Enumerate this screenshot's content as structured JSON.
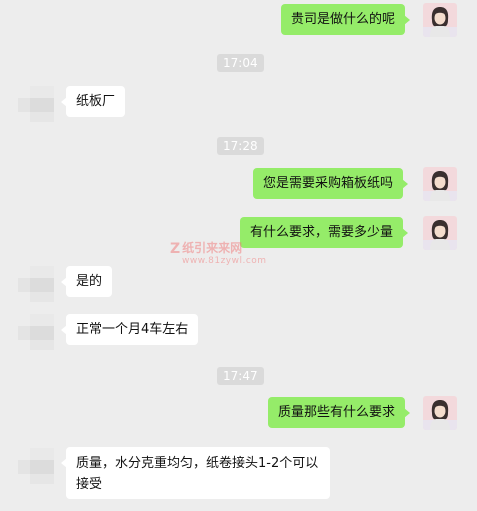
{
  "messages": [
    {
      "text": "贵司是做什么的呢"
    },
    {
      "text": "纸板厂"
    },
    {
      "text": "您是需要采购箱板纸吗"
    },
    {
      "text": "有什么要求，需要多少量"
    },
    {
      "text": "是的"
    },
    {
      "text": "正常一个月4车左右"
    },
    {
      "text": "质量那些有什么要求"
    },
    {
      "text": "质量，水分克重均匀，纸卷接头1-2个可以接受"
    }
  ],
  "timestamps": [
    "17:04",
    "17:28",
    "17:47"
  ],
  "watermark": {
    "brand": "纸引来来网",
    "url": "www.81zywl.com"
  },
  "colors": {
    "background": "#ededed",
    "my_bubble": "#95ec69",
    "their_bubble": "#ffffff",
    "timestamp_bg": "#dadada"
  },
  "icons": {
    "my_avatar": "user-avatar-photo",
    "their_avatar": "blurred-avatar"
  }
}
